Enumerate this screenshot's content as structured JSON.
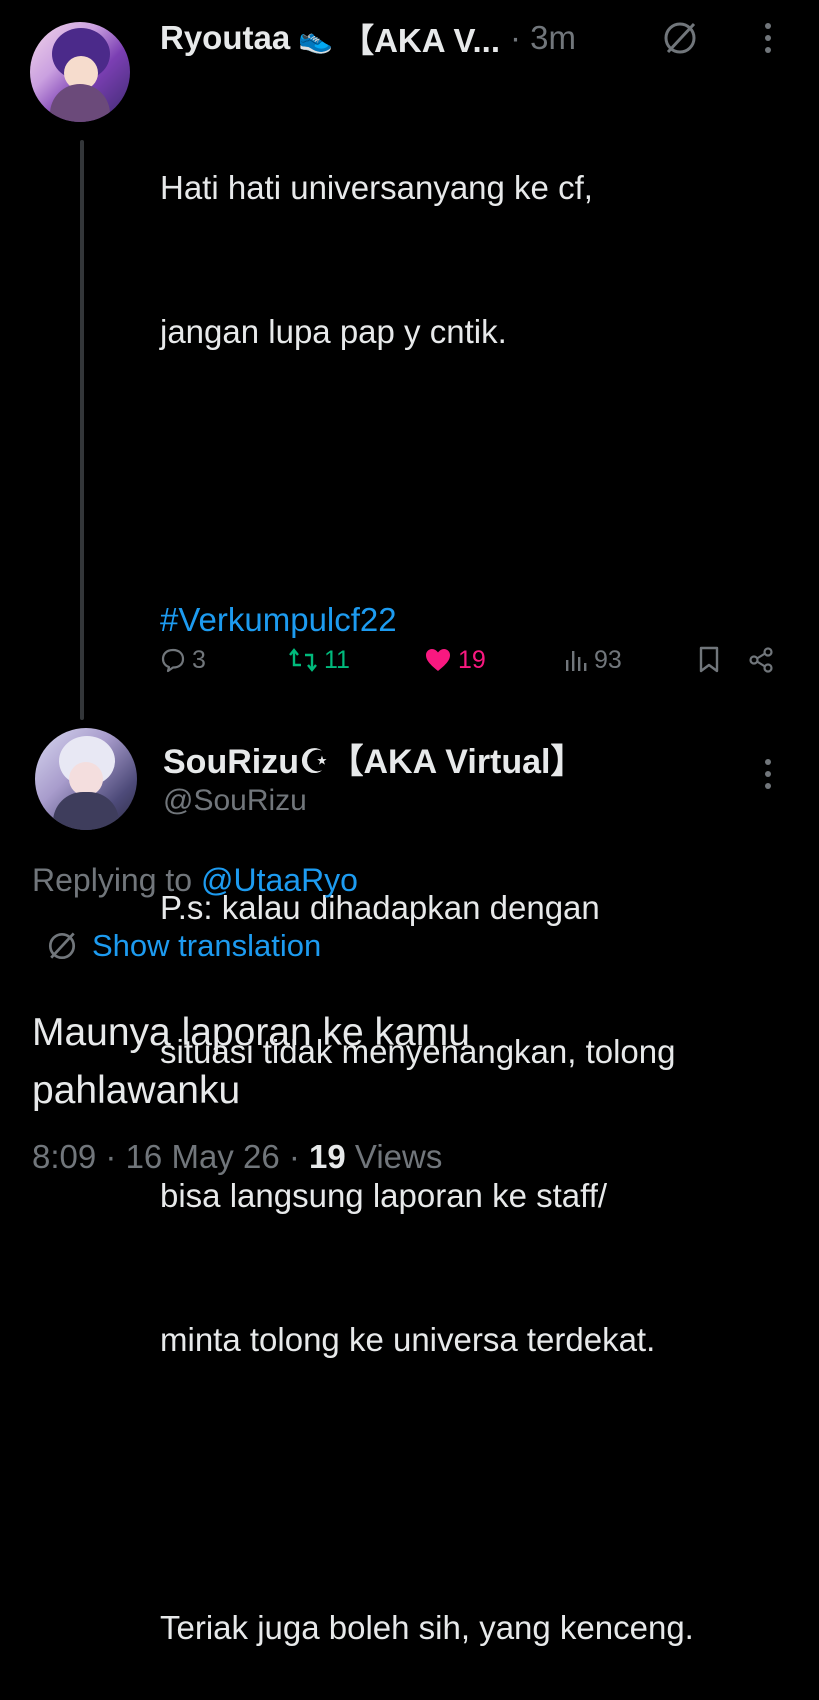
{
  "parent_tweet": {
    "display_name": "Ryoutaa",
    "name_emoji": "👟",
    "name_suffix": "【AKA V...",
    "time": "· 3m",
    "lines": [
      "Hati hati universanyang ke cf,",
      "jangan lupa pap y cntik.",
      "",
      "#Verkumpulcf22",
      "",
      "P.s: kalau dihadapkan dengan",
      "situasi tidak menyenangkan, tolong",
      "bisa langsung laporan ke staff/",
      "minta tolong ke universa terdekat.",
      "",
      "Teriak juga boleh sih, yang kenceng."
    ],
    "hashtag": "#Verkumpulcf22",
    "actions": {
      "replies": "3",
      "reposts": "11",
      "likes": "19",
      "views": "93"
    }
  },
  "reply_tweet": {
    "display_name": "SouRizu☪︎【AKA Virtual】",
    "handle": "@SouRizu",
    "replying_prefix": "Replying to",
    "replying_to": "@UtaaRyo",
    "show_translation": "Show translation",
    "text_line1": "Maunya laporan ke kamu",
    "text_line2": "pahlawanku",
    "time": "8:09",
    "date": "16 May 26",
    "views_count": "19",
    "views_label": "Views"
  },
  "colors": {
    "background": "#000000",
    "text": "#e7e9ea",
    "muted": "#71767b",
    "link": "#1d9bf0",
    "repost": "#00ba7c",
    "like": "#f91880"
  },
  "icons": [
    "avatar",
    "translate-icon",
    "more-icon",
    "reply-icon",
    "repost-icon",
    "like-icon",
    "views-icon",
    "bookmark-icon",
    "share-icon"
  ]
}
